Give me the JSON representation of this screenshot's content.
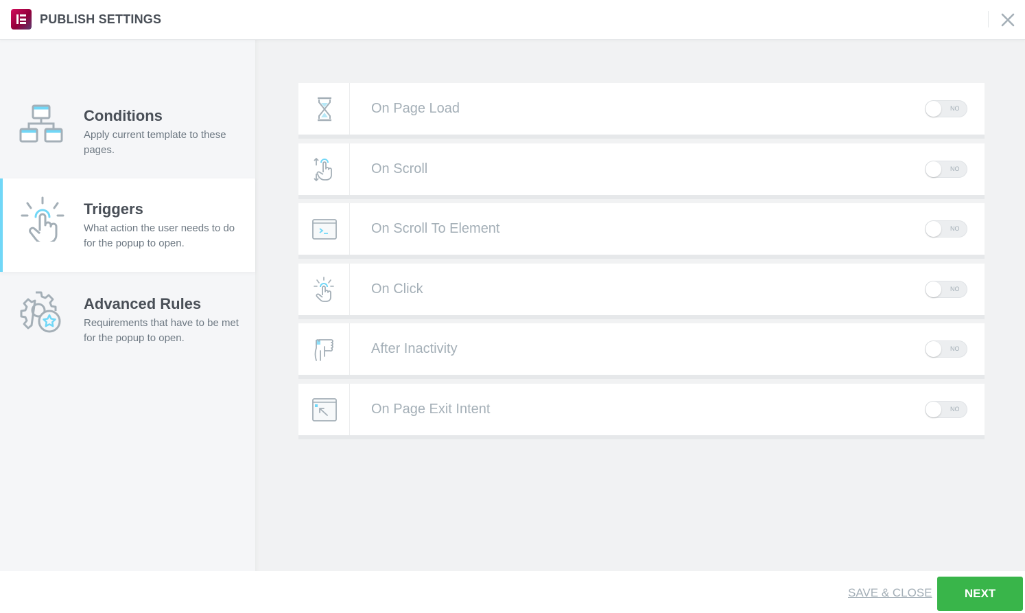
{
  "header": {
    "title": "PUBLISH SETTINGS",
    "logo_icon": "elementor-logo-icon",
    "close_icon": "close-icon"
  },
  "sidebar": {
    "items": [
      {
        "title": "Conditions",
        "description": "Apply current template to these pages.",
        "icon": "sitemap-icon",
        "active": false
      },
      {
        "title": "Triggers",
        "description": "What action the user needs to do for the popup to open.",
        "icon": "tap-hand-icon",
        "active": true
      },
      {
        "title": "Advanced Rules",
        "description": "Requirements that have to be met for the popup to open.",
        "icon": "gear-star-icon",
        "active": false
      }
    ]
  },
  "triggers": [
    {
      "label": "On Page Load",
      "icon": "hourglass-icon",
      "toggle": "NO",
      "enabled": false
    },
    {
      "label": "On Scroll",
      "icon": "scroll-hand-icon",
      "toggle": "NO",
      "enabled": false
    },
    {
      "label": "On Scroll To Element",
      "icon": "terminal-window-icon",
      "toggle": "NO",
      "enabled": false
    },
    {
      "label": "On Click",
      "icon": "click-hand-icon",
      "toggle": "NO",
      "enabled": false
    },
    {
      "label": "After Inactivity",
      "icon": "inactive-hand-icon",
      "toggle": "NO",
      "enabled": false
    },
    {
      "label": "On Page Exit Intent",
      "icon": "exit-window-icon",
      "toggle": "NO",
      "enabled": false
    }
  ],
  "footer": {
    "save_close_label": "SAVE & CLOSE",
    "next_label": "NEXT"
  },
  "colors": {
    "accent": "#71d7f7",
    "primary_button": "#39b54a",
    "brand": "#92003b"
  }
}
